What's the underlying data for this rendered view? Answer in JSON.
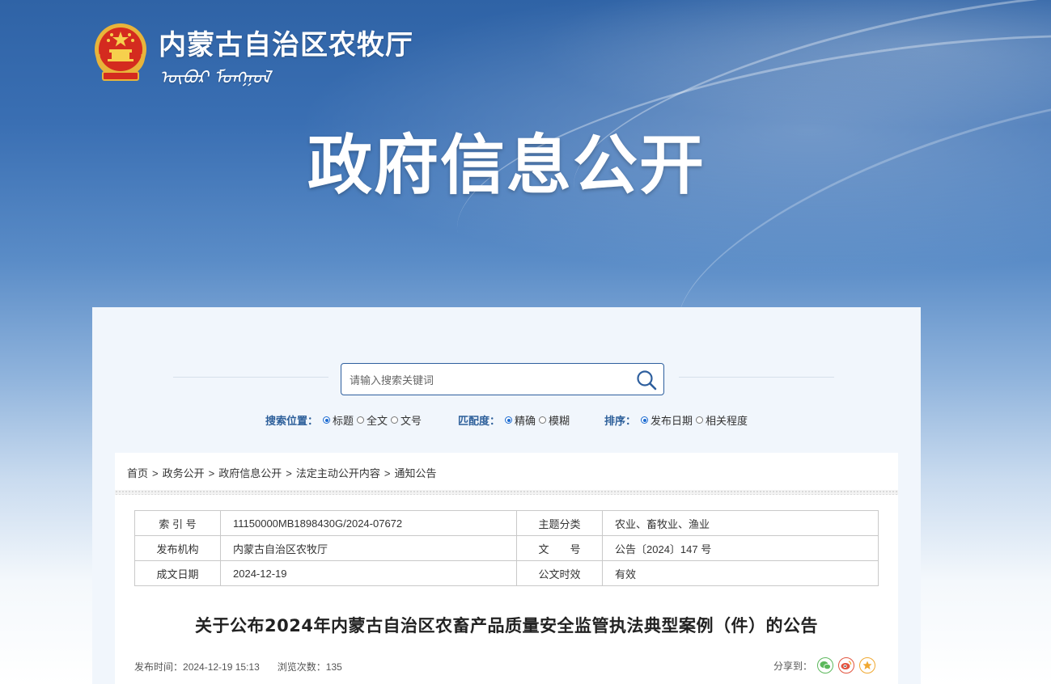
{
  "header": {
    "site_name_cn": "内蒙古自治区农牧厅",
    "site_name_mn": "ᠥᠪᠦᠷ ᠮᠣᠩᠭᠣᠯ",
    "banner_title": "政府信息公开"
  },
  "search": {
    "placeholder": "请输入搜索关键词",
    "position": {
      "label": "搜索位置：",
      "options": [
        "标题",
        "全文",
        "文号"
      ],
      "selected": "标题"
    },
    "match": {
      "label": "匹配度：",
      "options": [
        "精确",
        "模糊"
      ],
      "selected": "精确"
    },
    "sort": {
      "label": "排序：",
      "options": [
        "发布日期",
        "相关程度"
      ],
      "selected": "发布日期"
    }
  },
  "breadcrumb": [
    "首页",
    "政务公开",
    "政府信息公开",
    "法定主动公开内容",
    "通知公告"
  ],
  "meta": {
    "index_no": {
      "key": "索 引 号",
      "value": "11150000MB1898430G/2024-07672"
    },
    "topic": {
      "key": "主题分类",
      "value": "农业、畜牧业、渔业"
    },
    "issuer": {
      "key": "发布机构",
      "value": "内蒙古自治区农牧厅"
    },
    "doc_no": {
      "key": "文　　号",
      "value": "公告〔2024〕147 号"
    },
    "date": {
      "key": "成文日期",
      "value": "2024-12-19"
    },
    "validity": {
      "key": "公文时效",
      "value": "有效"
    }
  },
  "article": {
    "title": "关于公布2024年内蒙古自治区农畜产品质量安全监管执法典型案例（件）的公告",
    "publish_label": "发布时间：",
    "publish_time": "2024-12-19 15:13",
    "views_label": "浏览次数：",
    "views": "135",
    "share_label": "分享到："
  },
  "colors": {
    "accent_blue": "#2d5f9a",
    "wechat": "#5cb85c",
    "weibo": "#e2553f",
    "favorite": "#f0a830"
  }
}
